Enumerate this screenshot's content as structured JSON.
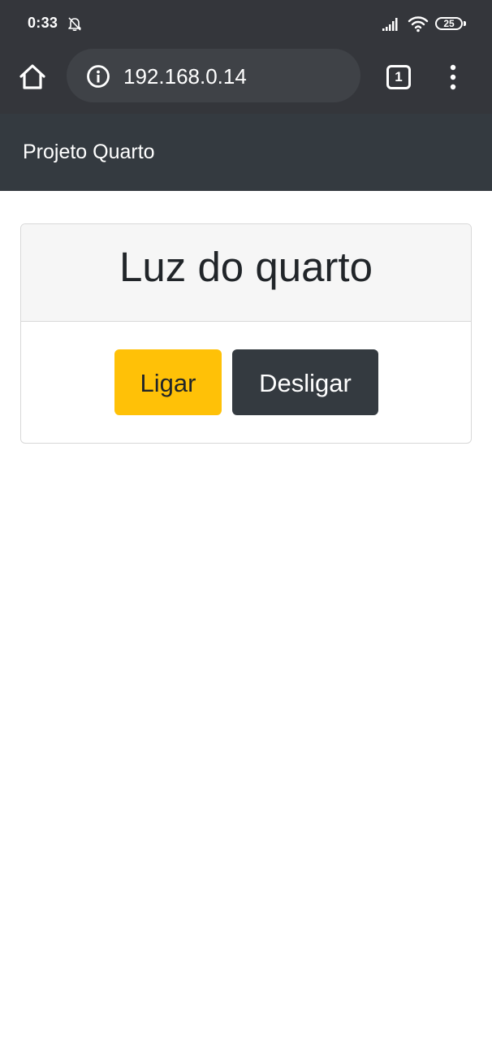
{
  "status_bar": {
    "time": "0:33",
    "battery": "25",
    "icons": [
      "bell-off-icon",
      "signal-icon",
      "wifi-icon",
      "battery-icon"
    ]
  },
  "browser": {
    "url": "192.168.0.14",
    "tab_count": "1",
    "icons": [
      "home-icon",
      "info-icon",
      "tab-switcher-icon",
      "menu-icon"
    ]
  },
  "navbar": {
    "brand": "Projeto Quarto"
  },
  "card": {
    "title": "Luz do quarto",
    "buttons": {
      "on_label": "Ligar",
      "off_label": "Desligar"
    }
  },
  "colors": {
    "browser_chrome": "#34363b",
    "navbar": "#343a40",
    "on_button": "#ffc107",
    "off_button": "#343a40"
  }
}
